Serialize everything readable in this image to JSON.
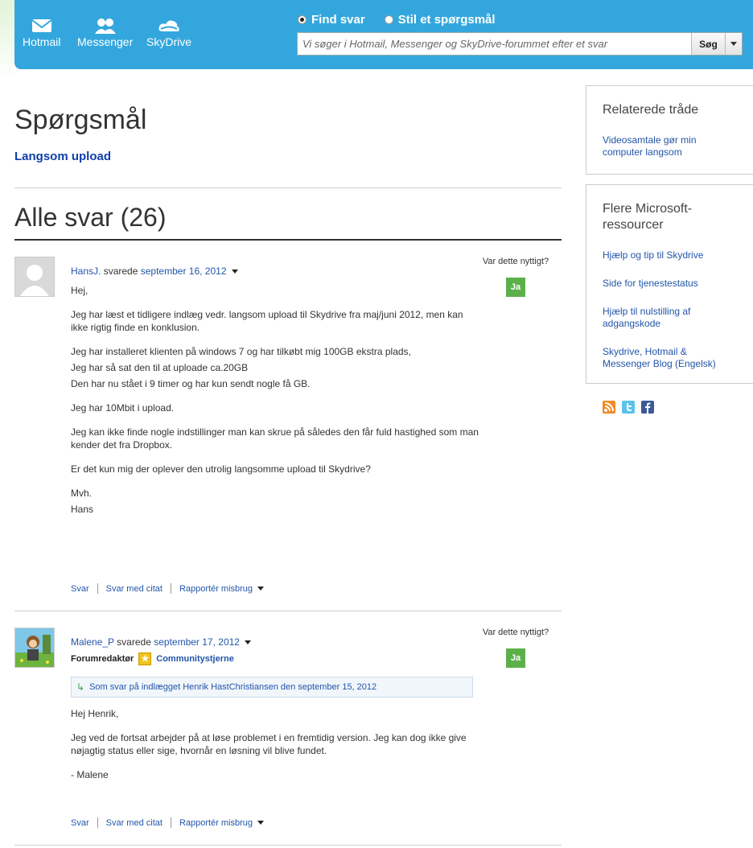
{
  "nav": {
    "items": [
      {
        "label": "Hotmail",
        "icon": "mail-icon"
      },
      {
        "label": "Messenger",
        "icon": "people-icon"
      },
      {
        "label": "SkyDrive",
        "icon": "cloud-icon"
      }
    ]
  },
  "search": {
    "option_find": "Find svar",
    "option_ask": "Stil et spørgsmål",
    "placeholder": "Vi søger i Hotmail, Messenger og SkyDrive-forummet efter et svar",
    "button": "Søg"
  },
  "question": {
    "heading": "Spørgsmål",
    "title": "Langsom upload"
  },
  "answers": {
    "heading": "Alle svar (26)",
    "useful_label": "Var dette nyttigt?",
    "yes": "Ja",
    "actions": [
      "Svar",
      "Svar med citat",
      "Rapportér misbrug"
    ]
  },
  "posts": [
    {
      "author": "HansJ.",
      "verb": "svarede",
      "date": "september 16, 2012",
      "paragraphs": [
        "Hej,",
        "Jeg har læst et tidligere indlæg vedr. langsom upload til Skydrive fra maj/juni 2012, men kan ikke rigtig finde en konklusion.",
        "Jeg har installeret klienten på windows 7 og har tilkøbt mig 100GB ekstra plads,",
        "Jeg har så sat den til at uploade ca.20GB",
        "Den har nu stået i 9 timer og har kun sendt nogle få GB.",
        "Jeg har 10Mbit i upload.",
        "Jeg kan ikke finde nogle indstillinger man kan skrue på således den får fuld hastighed som man kender det fra Dropbox.",
        "Er det kun mig der oplever den utrolig langsomme upload til Skydrive?",
        "Mvh.",
        "Hans"
      ]
    },
    {
      "author": "Malene_P",
      "verb": "svarede",
      "date": "september 17, 2012",
      "role": "Forumredaktør",
      "badge": "Communitystjerne",
      "reply_to": "Som svar på indlægget Henrik HastChristiansen den september 15, 2012",
      "paragraphs": [
        "Hej Henrik,",
        "Jeg ved de fortsat arbejder på at løse problemet i en fremtidig version. Jeg kan dog ikke give nøjagtig status eller sige, hvornår en løsning vil blive fundet.",
        "- Malene"
      ]
    }
  ],
  "sidebar": {
    "related_title": "Relaterede tråde",
    "related_links": [
      "Videosamtale gør min computer langsom"
    ],
    "more_title": "Flere Microsoft-ressourcer",
    "more_links": [
      "Hjælp og tip til Skydrive",
      "Side for tjenestestatus",
      "Hjælp til nulstilling af adgangskode",
      "Skydrive, Hotmail & Messenger Blog (Engelsk)"
    ]
  },
  "colors": {
    "header": "#33a7dd",
    "link": "#2255aa",
    "yes_button": "#5cb04a"
  }
}
